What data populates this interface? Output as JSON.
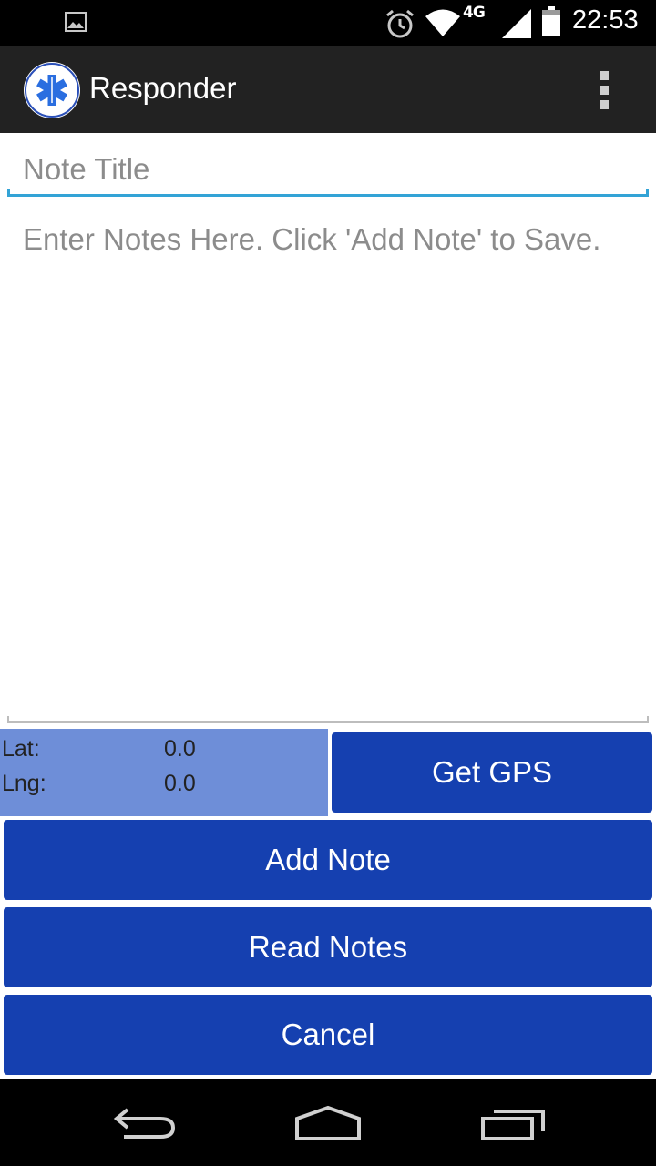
{
  "status_bar": {
    "time": "22:53",
    "network_label": "4G",
    "icons": [
      "gallery-notification-icon",
      "alarm-icon",
      "wifi-icon",
      "signal-icon",
      "battery-icon"
    ]
  },
  "action_bar": {
    "title": "Responder",
    "logo": "star-of-life-icon"
  },
  "form": {
    "title_placeholder": "Note Title",
    "title_value": "",
    "body_placeholder": "Enter Notes Here. Click 'Add Note' to Save.",
    "body_value": ""
  },
  "gps": {
    "lat_label": "Lat:",
    "lat_value": "0.0",
    "lng_label": "Lng:",
    "lng_value": "0.0",
    "get_gps_label": "Get GPS"
  },
  "buttons": {
    "add_note": "Add Note",
    "read_notes": "Read Notes",
    "cancel": "Cancel"
  },
  "colors": {
    "accent_underline": "#33a3d6",
    "button_blue": "#1540b0",
    "gps_panel": "#6e8ed8",
    "action_bar": "#222222"
  }
}
